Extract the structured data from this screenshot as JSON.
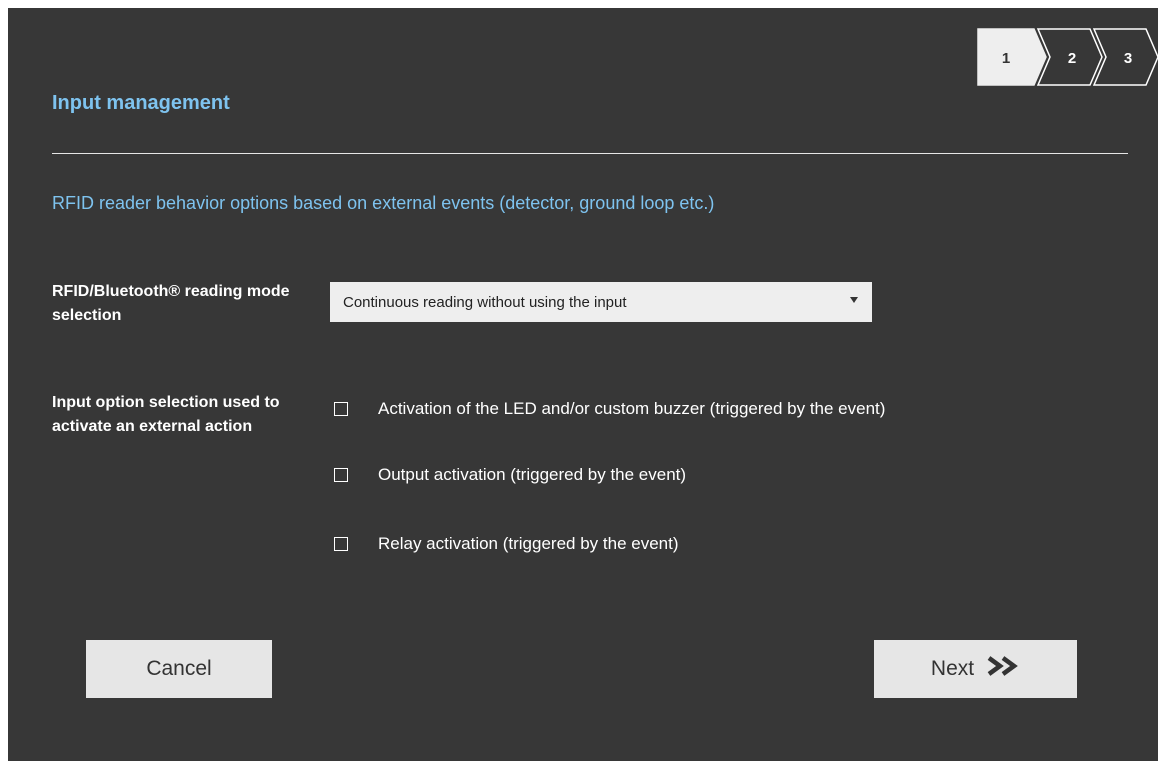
{
  "dialog": {
    "title": "Input management",
    "subtitle": "RFID reader behavior options based on external events (detector, ground loop etc.)"
  },
  "stepper": {
    "steps": [
      "1",
      "2",
      "3"
    ],
    "active_step": 1,
    "active_color": "#eeeeee",
    "inactive_color": "#373737"
  },
  "reading_mode": {
    "label": "RFID/Bluetooth® reading mode selection",
    "selected": "Continuous reading without using the input"
  },
  "input_options": {
    "label": "Input option selection used to activate an external action",
    "options": [
      {
        "label": "Activation of the LED and/or custom buzzer (triggered by the event)",
        "checked": false
      },
      {
        "label": "Output activation (triggered by the event)",
        "checked": false
      },
      {
        "label": "Relay activation (triggered by the event)",
        "checked": false
      }
    ]
  },
  "footer": {
    "cancel_label": "Cancel",
    "next_label": "Next",
    "next_icon": "double-chevron-right-icon"
  },
  "colors": {
    "background": "#373737",
    "accent": "#7ec3ef",
    "button": "#e6e6e6"
  }
}
